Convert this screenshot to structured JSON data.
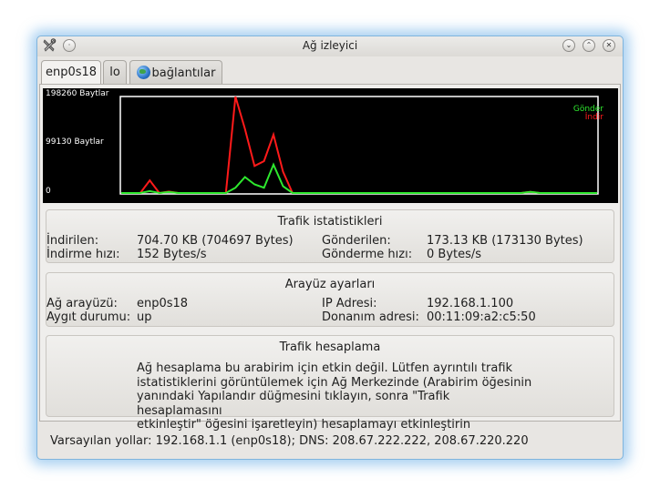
{
  "window": {
    "title": "Ağ izleyici",
    "close_glyph": "✕",
    "menu_glyph": "·",
    "min_glyph": "⌄",
    "max_glyph": "⌃",
    "accent_color": "#7fb4dd"
  },
  "tabs": [
    {
      "label": "enp0s18",
      "active": true
    },
    {
      "label": "lo",
      "active": false
    },
    {
      "label": "bağlantılar",
      "active": false,
      "icon": "globe-icon"
    }
  ],
  "graph": {
    "y_max_label": "198260 Baytlar",
    "y_mid_label": "99130 Baytlar",
    "y_min_label": "0",
    "legend_send": "Gönder",
    "legend_recv": "İndir",
    "send_color": "#2ee82e",
    "recv_color": "#ff1a1a"
  },
  "chart_data": {
    "type": "line",
    "ylim": [
      0,
      198260
    ],
    "y_ticks": [
      "0",
      "99130 Baytlar",
      "198260 Baytlar"
    ],
    "legend_placement": "top-right",
    "x": [
      0,
      1,
      2,
      3,
      4,
      5,
      6,
      7,
      8,
      9,
      10,
      11,
      12,
      13,
      14,
      15,
      16,
      17,
      18,
      19,
      20,
      21,
      22,
      23,
      24,
      25,
      26,
      27,
      28,
      29,
      30,
      31,
      32,
      33,
      34,
      35,
      36,
      37,
      38,
      39,
      40,
      41,
      42,
      43,
      44,
      45,
      46,
      47,
      48,
      49,
      50
    ],
    "series": [
      {
        "name": "İndir",
        "color": "#ff1a1a",
        "values": [
          0,
          0,
          0,
          26000,
          0,
          3000,
          0,
          0,
          0,
          0,
          0,
          0,
          200000,
          133000,
          56000,
          66000,
          121000,
          44000,
          0,
          0,
          0,
          0,
          0,
          0,
          0,
          0,
          0,
          0,
          0,
          0,
          0,
          0,
          0,
          0,
          0,
          0,
          0,
          0,
          0,
          0,
          0,
          0,
          0,
          2500,
          0,
          0,
          0,
          0,
          0,
          0,
          0
        ]
      },
      {
        "name": "Gönder",
        "color": "#2ee82e",
        "values": [
          0,
          0,
          0,
          4000,
          0,
          2000,
          0,
          0,
          0,
          0,
          0,
          0,
          11000,
          33000,
          18000,
          11000,
          59000,
          14000,
          0,
          0,
          0,
          0,
          0,
          0,
          0,
          0,
          0,
          0,
          0,
          0,
          0,
          0,
          0,
          0,
          0,
          0,
          0,
          0,
          0,
          0,
          0,
          0,
          0,
          2500,
          0,
          0,
          0,
          0,
          0,
          0,
          0
        ]
      }
    ]
  },
  "traffic_stats": {
    "title": "Trafik istatistikleri",
    "downloaded_label": "İndirilen:",
    "downloaded_value": "704.70 KB (704697 Bytes)",
    "download_rate_label": "İndirme hızı:",
    "download_rate_value": "152 Bytes/s",
    "sent_label": "Gönderilen:",
    "sent_value": "173.13 KB (173130 Bytes)",
    "send_rate_label": "Gönderme hızı:",
    "send_rate_value": "0 Bytes/s"
  },
  "interface_settings": {
    "title": "Arayüz ayarları",
    "interface_label": "Ağ arayüzü:",
    "interface_value": "enp0s18",
    "device_state_label": "Aygıt durumu:",
    "device_state_value": "up",
    "ip_label": "IP Adresi:",
    "ip_value": "192.168.1.100",
    "hw_label": "Donanım adresi:",
    "hw_value": "00:11:09:a2:c5:50"
  },
  "traffic_accounting": {
    "title": "Trafik hesaplama",
    "message_lines": [
      "Ağ hesaplama bu arabirim için etkin değil. Lütfen ayrıntılı trafik",
      "istatistiklerini görüntülemek için Ağ Merkezinde (Arabirim öğesinin",
      "yanındaki Yapılandır düğmesini tıklayın, sonra \"Trafik hesaplamasını",
      "etkinleştir\" öğesini işaretleyin) hesaplamayı etkinleştirin"
    ]
  },
  "status": {
    "text": "Varsayılan yollar: 192.168.1.1 (enp0s18); DNS: 208.67.222.222, 208.67.220.220"
  }
}
